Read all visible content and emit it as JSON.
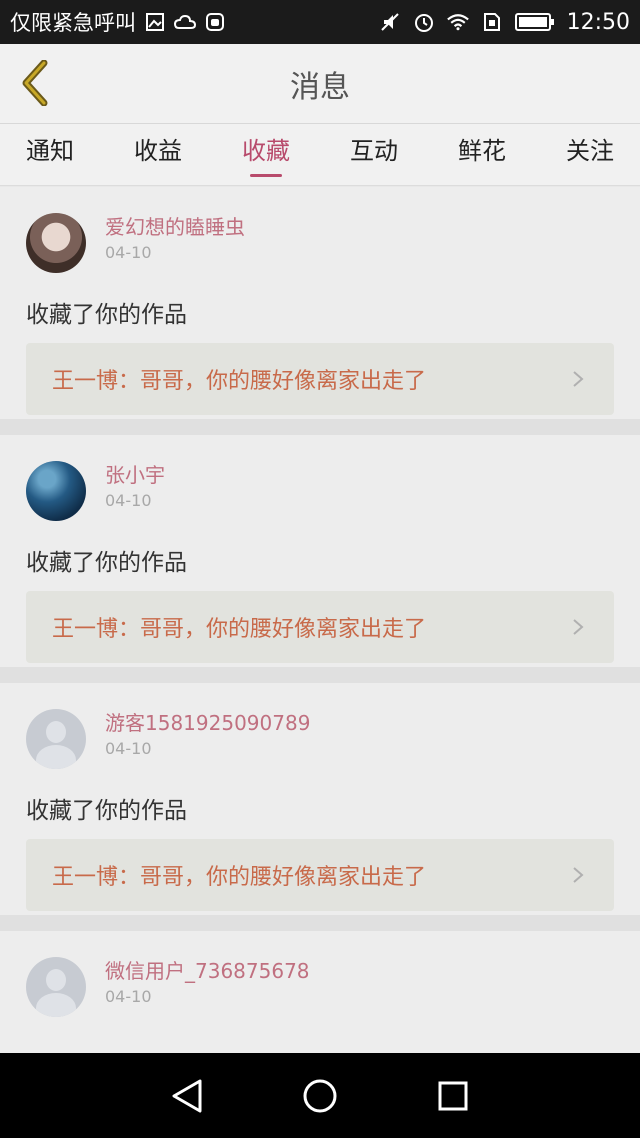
{
  "status_bar": {
    "carrier": "仅限紧急呼叫",
    "time": "12:50",
    "icons": [
      "image-icon",
      "cloud-icon",
      "android-icon",
      "mute-icon",
      "alarm-icon",
      "wifi-icon",
      "sim-icon",
      "battery-icon"
    ]
  },
  "header": {
    "title": "消息",
    "back_icon": "back-chevron-icon"
  },
  "tabs": [
    {
      "label": "通知",
      "active": false
    },
    {
      "label": "收益",
      "active": false
    },
    {
      "label": "收藏",
      "active": true
    },
    {
      "label": "互动",
      "active": false
    },
    {
      "label": "鲜花",
      "active": false
    },
    {
      "label": "关注",
      "active": false
    }
  ],
  "items": [
    {
      "username": "爱幻想的瞌睡虫",
      "date": "04-10",
      "action": "收藏了你的作品",
      "work": "王一博：哥哥，你的腰好像离家出走了"
    },
    {
      "username": "张小宇",
      "date": "04-10",
      "action": "收藏了你的作品",
      "work": "王一博：哥哥，你的腰好像离家出走了"
    },
    {
      "username": "游客1581925090789",
      "date": "04-10",
      "action": "收藏了你的作品",
      "work": "王一博：哥哥，你的腰好像离家出走了"
    },
    {
      "username": "微信用户_736875678",
      "date": "04-10",
      "action": "",
      "work": ""
    }
  ],
  "nav_bar": {
    "buttons": [
      "back-triangle-icon",
      "home-circle-icon",
      "recents-square-icon"
    ]
  },
  "colors": {
    "accent": "#b84b6c",
    "username": "#c07080",
    "work_link": "#c86a4a"
  }
}
